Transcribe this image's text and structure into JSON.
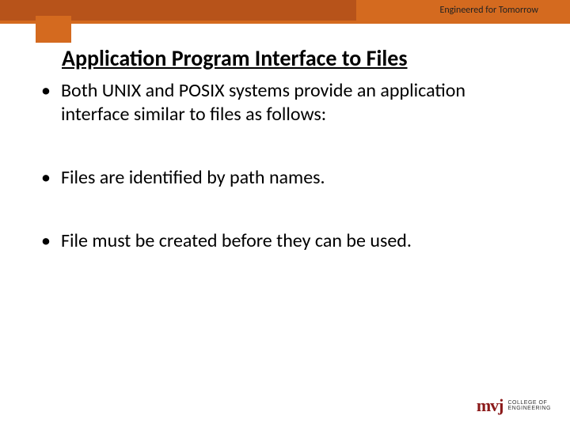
{
  "header": {
    "tagline": "Engineered for Tomorrow"
  },
  "title": "Application Program Interface to Files",
  "bullets": [
    "Both UNIX and POSIX systems provide an application interface similar to files as follows:",
    "Files are identified by path names.",
    "File must be created before they can be used."
  ],
  "footer": {
    "logo_mark": "mvj",
    "logo_line1": "COLLEGE OF",
    "logo_line2": "ENGINEERING"
  }
}
